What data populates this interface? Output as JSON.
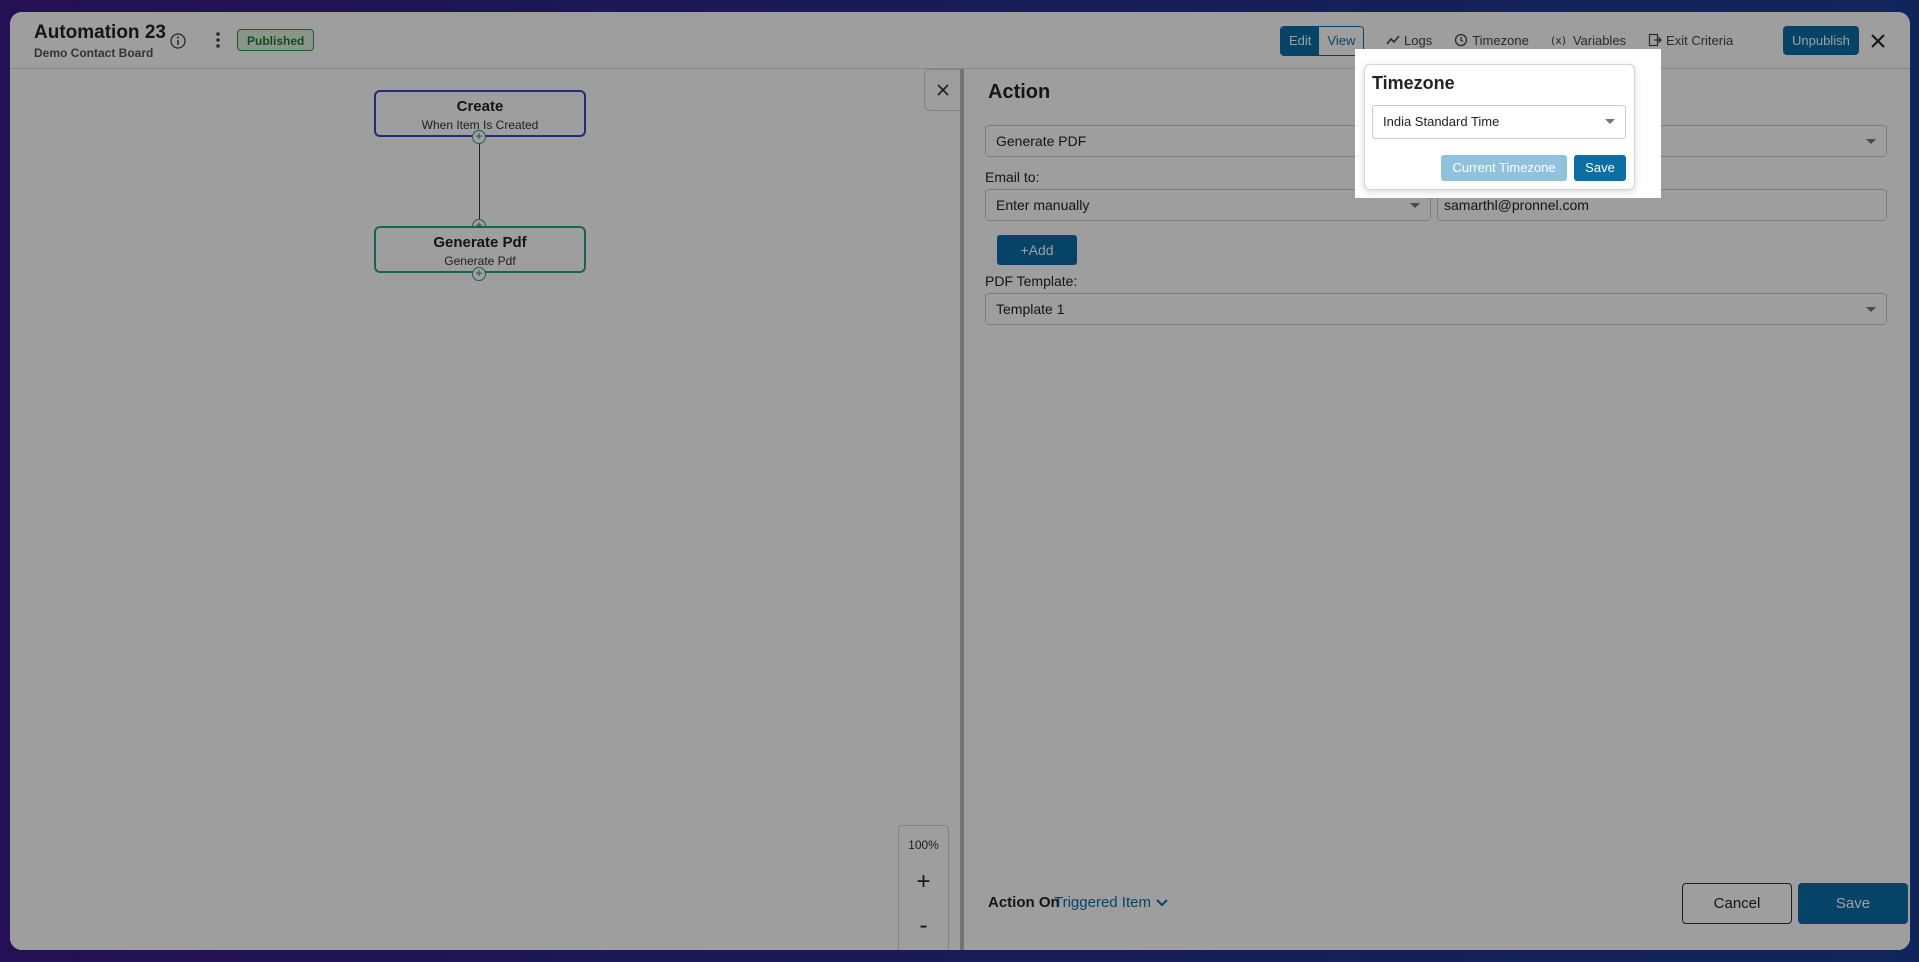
{
  "header": {
    "title": "Automation 23",
    "subtitle": "Demo Contact Board",
    "status": "Published",
    "toggle": {
      "edit": "Edit",
      "view": "View"
    },
    "links": {
      "logs": "Logs",
      "timezone": "Timezone",
      "variables": "Variables",
      "exit_criteria": "Exit Criteria"
    },
    "unpublish": "Unpublish"
  },
  "canvas": {
    "nodes": [
      {
        "title": "Create",
        "subtitle": "When Item Is Created"
      },
      {
        "title": "Generate Pdf",
        "subtitle": "Generate Pdf"
      }
    ],
    "zoom_level": "100%",
    "zoom_in": "+",
    "zoom_out": "-"
  },
  "panel": {
    "title": "Action",
    "action_type": "Generate PDF",
    "email_label": "Email to:",
    "email_mode": "Enter manually",
    "email_value": "samarthl@pronnel.com",
    "add_label": "+Add",
    "template_label": "PDF Template:",
    "template_value": "Template 1",
    "action_on_label": "Action On",
    "action_on_value": "Triggered Item",
    "cancel": "Cancel",
    "save": "Save"
  },
  "timezone_popover": {
    "title": "Timezone",
    "selected": "India Standard Time",
    "current_button": "Current Timezone",
    "save_button": "Save"
  },
  "colors": {
    "accent": "#0b6fa6",
    "published": "#2e9b47",
    "create_node_border": "#3848c8",
    "pdf_node_border": "#22a08a"
  }
}
